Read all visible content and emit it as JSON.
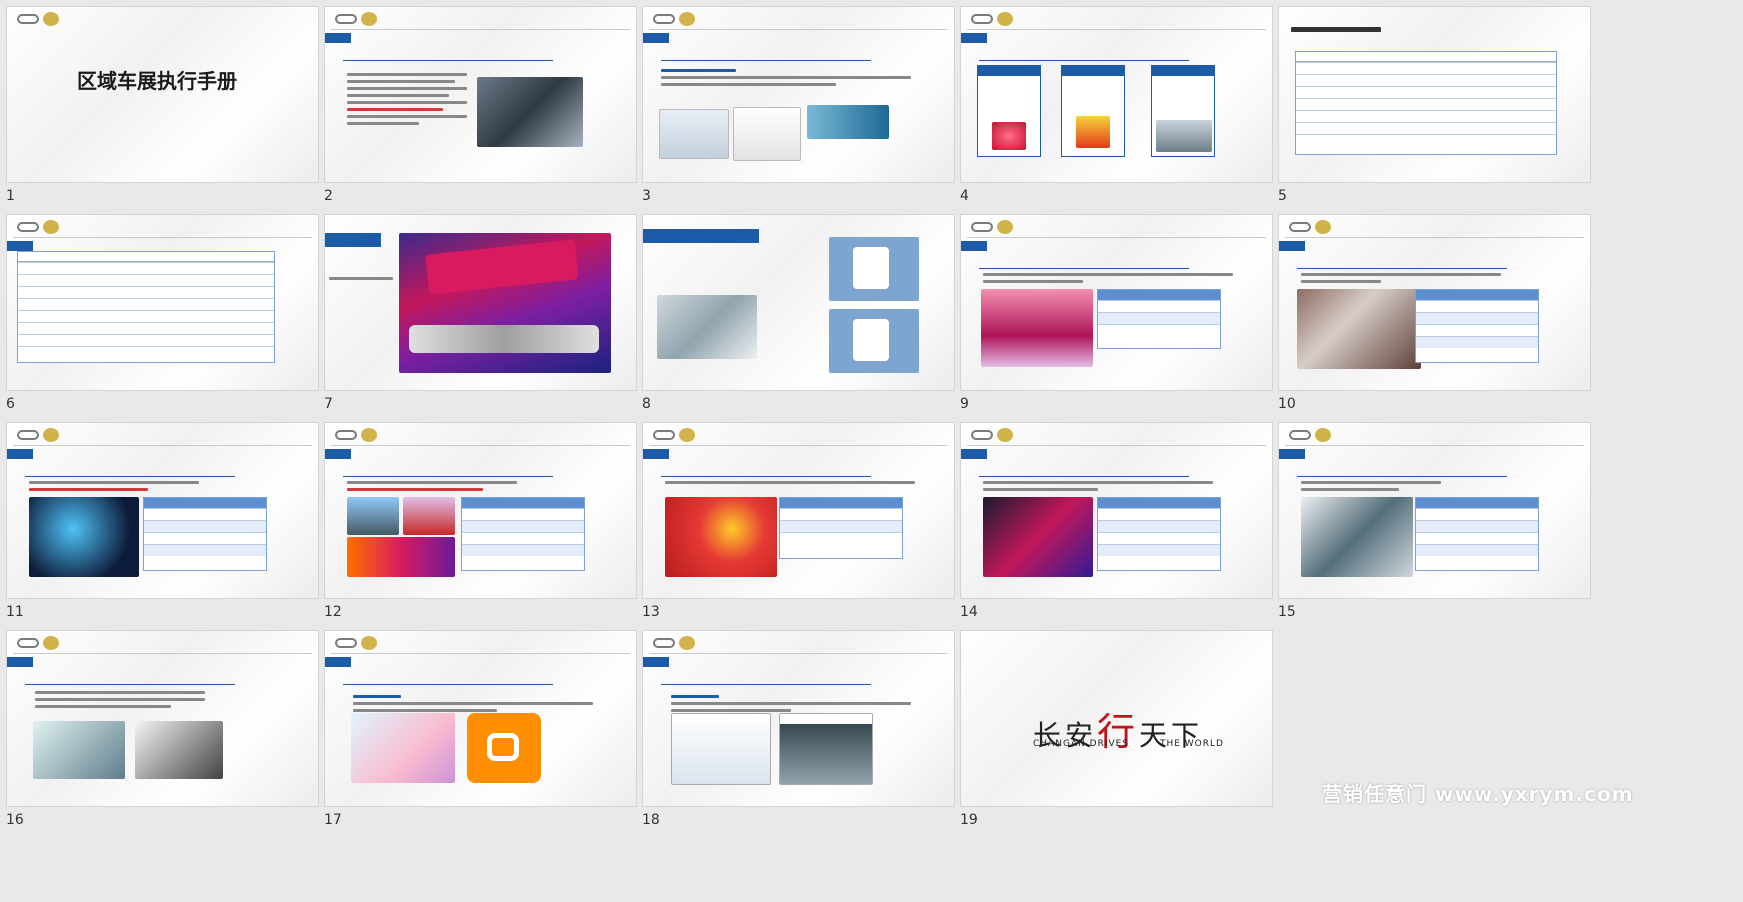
{
  "slides": [
    {
      "number": "1",
      "title": "区域车展执行手册"
    },
    {
      "number": "2"
    },
    {
      "number": "3"
    },
    {
      "number": "4"
    },
    {
      "number": "5"
    },
    {
      "number": "6"
    },
    {
      "number": "7"
    },
    {
      "number": "8"
    },
    {
      "number": "9"
    },
    {
      "number": "10"
    },
    {
      "number": "11"
    },
    {
      "number": "12"
    },
    {
      "number": "13"
    },
    {
      "number": "14"
    },
    {
      "number": "15"
    },
    {
      "number": "16"
    },
    {
      "number": "17"
    },
    {
      "number": "18"
    },
    {
      "number": "19",
      "brand_cn_1": "长安",
      "brand_cn_2": "行",
      "brand_cn_3": "天下",
      "brand_en_1": "CHANGAN DRIVES",
      "brand_en_2": "THE WORLD"
    }
  ],
  "watermark": "营销任意门 www.yxrym.com",
  "colors": {
    "accent": "#1d5aa7",
    "highlight": "#d23a3a",
    "background": "#e9e9e9"
  }
}
